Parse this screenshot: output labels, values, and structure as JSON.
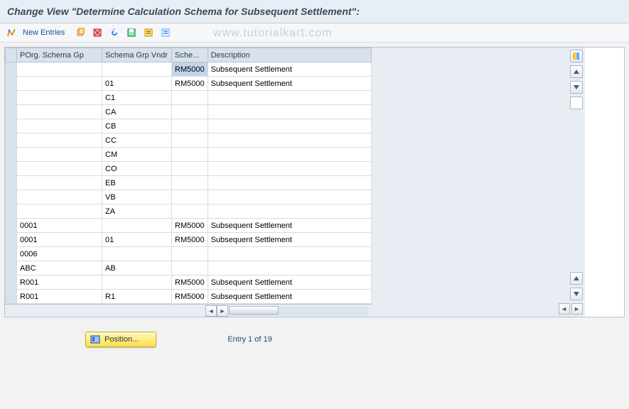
{
  "title": "Change View \"Determine Calculation Schema for Subsequent Settlement\":",
  "toolbar": {
    "new_entries": "New Entries"
  },
  "watermark": "www.tutorialkart.com",
  "columns": {
    "porg": "POrg. Schema Gp",
    "vndr": "Schema Grp Vndr",
    "sche": "Sche...",
    "desc": "Description"
  },
  "rows": [
    {
      "porg": "",
      "vndr": "",
      "sche": "RM5000",
      "desc": "Subsequent Settlement",
      "sel": true
    },
    {
      "porg": "",
      "vndr": "01",
      "sche": "RM5000",
      "desc": "Subsequent Settlement"
    },
    {
      "porg": "",
      "vndr": "C1",
      "sche": "",
      "desc": ""
    },
    {
      "porg": "",
      "vndr": "CA",
      "sche": "",
      "desc": ""
    },
    {
      "porg": "",
      "vndr": "CB",
      "sche": "",
      "desc": ""
    },
    {
      "porg": "",
      "vndr": "CC",
      "sche": "",
      "desc": ""
    },
    {
      "porg": "",
      "vndr": "CM",
      "sche": "",
      "desc": ""
    },
    {
      "porg": "",
      "vndr": "CO",
      "sche": "",
      "desc": ""
    },
    {
      "porg": "",
      "vndr": "EB",
      "sche": "",
      "desc": ""
    },
    {
      "porg": "",
      "vndr": "VB",
      "sche": "",
      "desc": ""
    },
    {
      "porg": "",
      "vndr": "ZA",
      "sche": "",
      "desc": ""
    },
    {
      "porg": "0001",
      "vndr": "",
      "sche": "RM5000",
      "desc": "Subsequent Settlement"
    },
    {
      "porg": "0001",
      "vndr": "01",
      "sche": "RM5000",
      "desc": "Subsequent Settlement"
    },
    {
      "porg": "0006",
      "vndr": "",
      "sche": "",
      "desc": ""
    },
    {
      "porg": "ABC",
      "vndr": "AB",
      "sche": "",
      "desc": ""
    },
    {
      "porg": "R001",
      "vndr": "",
      "sche": "RM5000",
      "desc": "Subsequent Settlement"
    },
    {
      "porg": "R001",
      "vndr": "R1",
      "sche": "RM5000",
      "desc": "Subsequent Settlement"
    }
  ],
  "footer": {
    "position": "Position...",
    "entry": "Entry 1 of 19"
  }
}
